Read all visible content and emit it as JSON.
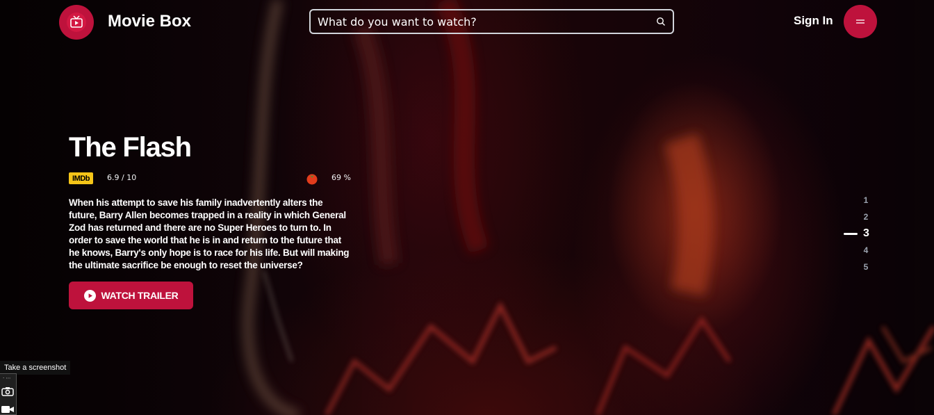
{
  "header": {
    "brand": "Movie Box",
    "search_placeholder": "What do you want to watch?",
    "sign_in": "Sign In"
  },
  "hero": {
    "title": "The Flash",
    "imdb_label": "IMDb",
    "imdb_rating": "6.9 / 10",
    "tomato_rating": "69 %",
    "description": "When his attempt to save his family inadvertently alters the future, Barry Allen becomes trapped in a reality in which General Zod has returned and there are no Super Heroes to turn to. In order to save the world that he is in and return to the future that he knows, Barry's only hope is to race for his life. But will making the ultimate sacrifice be enough to reset the universe?",
    "watch_trailer": "WATCH TRAILER"
  },
  "pagination": {
    "items": [
      "1",
      "2",
      "3",
      "4",
      "5"
    ],
    "active": "3"
  },
  "screenshot_widget": {
    "tooltip": "Take a screenshot"
  },
  "colors": {
    "accent": "#be123c",
    "imdb": "#f5c518"
  }
}
